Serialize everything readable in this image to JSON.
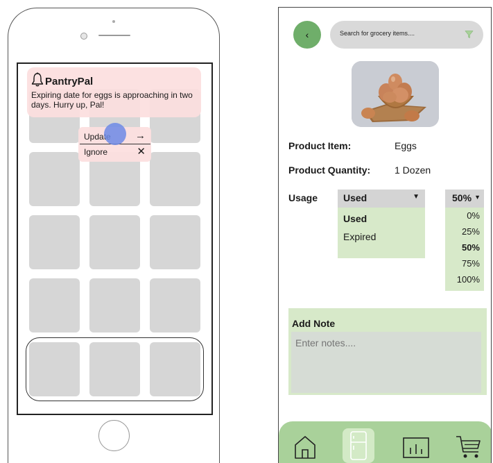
{
  "left_screen": {
    "notification": {
      "app_name": "PantryPal",
      "message": "Expiring date for eggs is approaching in two days. Hurry up, Pal!",
      "icon": "bell-icon"
    },
    "actions": {
      "update_label": "Update",
      "update_icon": "arrow-right-icon",
      "ignore_label": "Ignore",
      "ignore_icon": "close-icon"
    }
  },
  "right_screen": {
    "search": {
      "placeholder": "Search for grocery items....",
      "filter_icon": "filter-icon"
    },
    "back_icon": "chevron-left-icon",
    "product": {
      "item_label": "Product Item:",
      "item_value": "Eggs",
      "quantity_label": "Product Quantity:",
      "quantity_value": "1 Dozen"
    },
    "usage": {
      "label": "Usage",
      "selected": "Used",
      "options": [
        "Used",
        "Expired"
      ],
      "percent_selected": "50%",
      "percent_options": [
        "0%",
        "25%",
        "50%",
        "75%",
        "100%"
      ]
    },
    "note": {
      "title": "Add Note",
      "placeholder": "Enter notes...."
    },
    "nav": {
      "items": [
        "home-icon",
        "pantry-fridge-icon",
        "stats-chart-icon",
        "cart-icon"
      ],
      "active": "pantry-fridge-icon"
    }
  },
  "colors": {
    "notification_bg": "#fcdfdf",
    "accent_green": "#6fae6a",
    "panel_green": "#d7e9c9",
    "nav_green": "#a9d19a",
    "touch_indicator": "#6c8ae6"
  }
}
